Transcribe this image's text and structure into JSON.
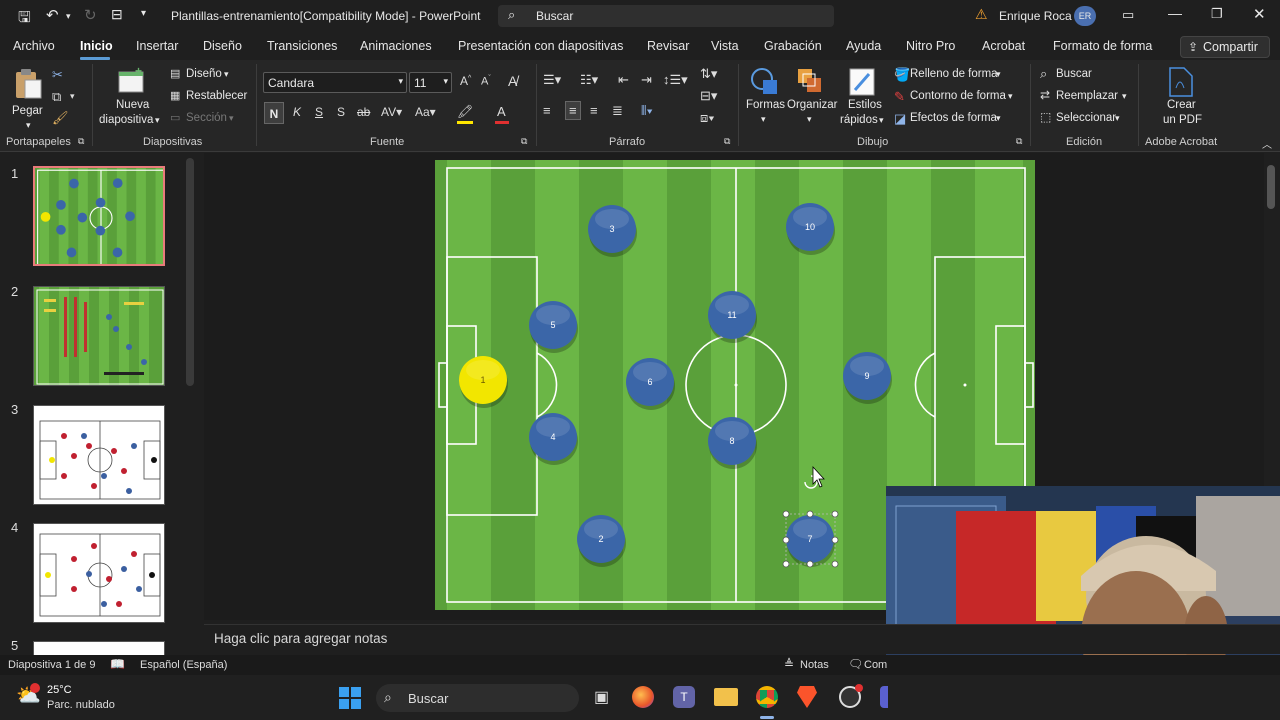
{
  "titlebar": {
    "doc_title": "Plantillas-entrenamiento[Compatibility Mode] - PowerPoint",
    "search": "Buscar",
    "user": "Enrique Roca",
    "initials": "ER"
  },
  "menu": {
    "items": [
      "Archivo",
      "Inicio",
      "Insertar",
      "Diseño",
      "Transiciones",
      "Animaciones",
      "Presentación con diapositivas",
      "Revisar",
      "Vista",
      "Grabación",
      "Ayuda",
      "Nitro Pro",
      "Acrobat",
      "Formato de forma"
    ],
    "share": "Compartir"
  },
  "ribbon": {
    "paste": "Pegar",
    "new_slide_1": "Nueva",
    "new_slide_2": "diapositiva",
    "layout": "Diseño",
    "reset": "Restablecer",
    "section": "Sección",
    "font_name": "Candara",
    "font_size": "11",
    "bold": "N",
    "italic": "K",
    "underline": "S",
    "strike": "S",
    "shapes": "Formas",
    "arrange": "Organizar",
    "quick_styles_1": "Estilos",
    "quick_styles_2": "rápidos",
    "fill": "Relleno de forma",
    "outline": "Contorno de forma",
    "effects": "Efectos de forma",
    "find": "Buscar",
    "replace": "Reemplazar",
    "select": "Seleccionar",
    "pdf_1": "Crear",
    "pdf_2": "un PDF",
    "groups": {
      "clipboard": "Portapapeles",
      "slides": "Diapositivas",
      "font": "Fuente",
      "paragraph": "Párrafo",
      "drawing": "Dibujo",
      "editing": "Edición",
      "acrobat": "Adobe Acrobat"
    }
  },
  "thumbnails": [
    "1",
    "2",
    "3",
    "4",
    "5"
  ],
  "slide": {
    "players": [
      {
        "n": "1",
        "color": "#f2e600"
      },
      {
        "n": "2",
        "color": "#3b66a8"
      },
      {
        "n": "3",
        "color": "#3b66a8"
      },
      {
        "n": "4",
        "color": "#3b66a8"
      },
      {
        "n": "5",
        "color": "#3b66a8"
      },
      {
        "n": "6",
        "color": "#3b66a8"
      },
      {
        "n": "7",
        "color": "#3b66a8"
      },
      {
        "n": "8",
        "color": "#3b66a8"
      },
      {
        "n": "9",
        "color": "#3b66a8"
      },
      {
        "n": "10",
        "color": "#3b66a8"
      },
      {
        "n": "11",
        "color": "#3b66a8"
      }
    ]
  },
  "notes_placeholder": "Haga clic para agregar notas",
  "status": {
    "slide_count": "Diapositiva 1 de 9",
    "language": "Español (España)",
    "notes": "Notas",
    "comments": "Com"
  },
  "taskbar": {
    "temp": "25°C",
    "weather": "Parc. nublado",
    "search": "Buscar"
  }
}
